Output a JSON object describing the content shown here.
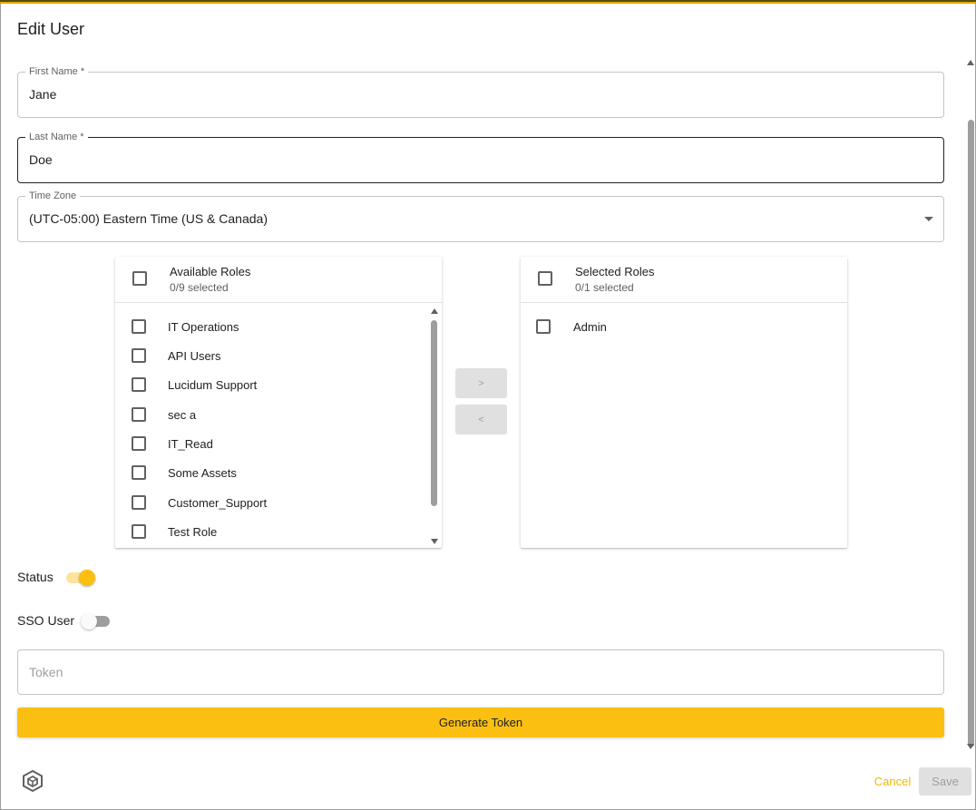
{
  "dialog": {
    "title": "Edit User"
  },
  "fields": {
    "first_name": {
      "label": "First Name *",
      "value": "Jane"
    },
    "last_name": {
      "label": "Last Name *",
      "value": "Doe"
    },
    "time_zone": {
      "label": "Time Zone",
      "value": "(UTC-05:00) Eastern Time (US & Canada)"
    }
  },
  "available_roles": {
    "title": "Available Roles",
    "count": "0/9 selected",
    "items": [
      "IT Operations",
      "API Users",
      "Lucidum Support",
      "sec a",
      "IT_Read",
      "Some Assets",
      "Customer_Support",
      "Test Role"
    ]
  },
  "selected_roles": {
    "title": "Selected Roles",
    "count": "0/1 selected",
    "items": [
      "Admin"
    ]
  },
  "transfer": {
    "move_right": ">",
    "move_left": "<"
  },
  "status": {
    "label": "Status",
    "on": true
  },
  "sso": {
    "label": "SSO User",
    "on": false
  },
  "token": {
    "placeholder": "Token",
    "value": ""
  },
  "buttons": {
    "generate": "Generate Token",
    "cancel": "Cancel",
    "save": "Save"
  },
  "icons": {
    "caret": "chevron-down-icon",
    "logo": "hexagon-cube-logo-icon",
    "scroll_up": "scroll-up-arrow-icon",
    "scroll_down": "scroll-down-arrow-icon"
  },
  "colors": {
    "accent": "#fbbf12",
    "accent_light": "#fde49a",
    "cancel_text": "#f3b705"
  }
}
